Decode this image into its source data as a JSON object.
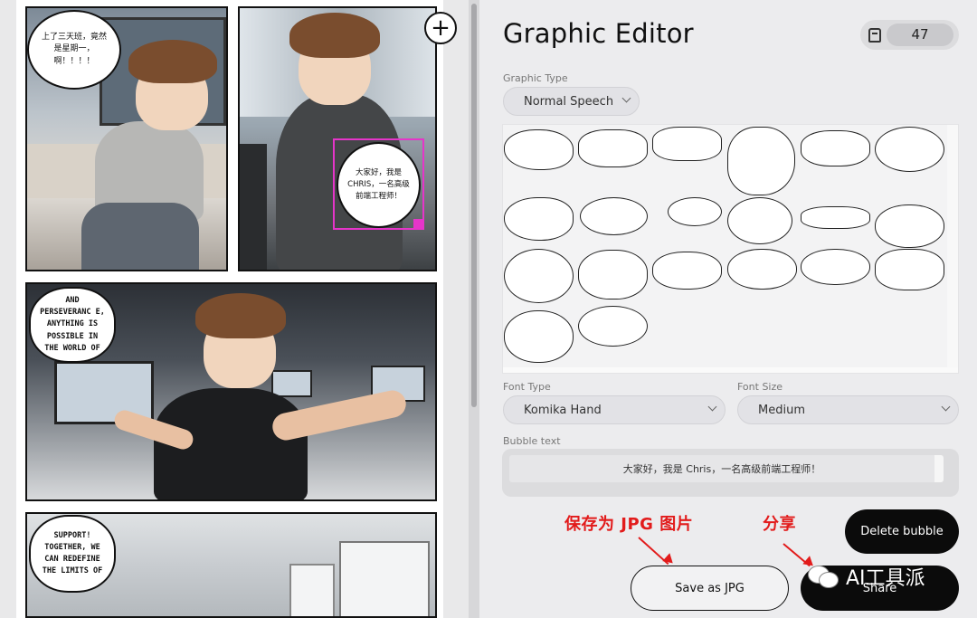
{
  "comic": {
    "panel1_bubble": "上了三天班，竟然是星期一，啊！！！！",
    "panel2_bubble": "大家好，我是 CHRIS，一名高级前端工程师！",
    "panel3_bubble": "AND PERSEVERANC E, ANYTHING IS POSSIBLE IN THE WORLD OF",
    "panel4_bubble": "SUPPORT! TOGETHER, WE CAN REDEFINE THE LIMITS OF",
    "add_panel_glyph": "+"
  },
  "editor": {
    "title": "Graphic Editor",
    "credits": "47",
    "graphic_type_label": "Graphic Type",
    "graphic_type_value": "Normal Speech",
    "font_type_label": "Font Type",
    "font_type_value": "Komika Hand",
    "font_size_label": "Font Size",
    "font_size_value": "Medium",
    "bubble_text_label": "Bubble text",
    "bubble_text_value": "大家好，我是 Chris，一名高级前端工程师！",
    "delete_label": "Delete bubble",
    "save_label": "Save as JPG",
    "share_label": "Share"
  },
  "annotations": {
    "save_note": "保存为 JPG 图片",
    "share_note": "分享",
    "color": "#e21b1b"
  },
  "watermark": {
    "text": "AI工具派"
  },
  "colors": {
    "selection": "#e535c9",
    "button_dark": "#0b0b0b"
  }
}
